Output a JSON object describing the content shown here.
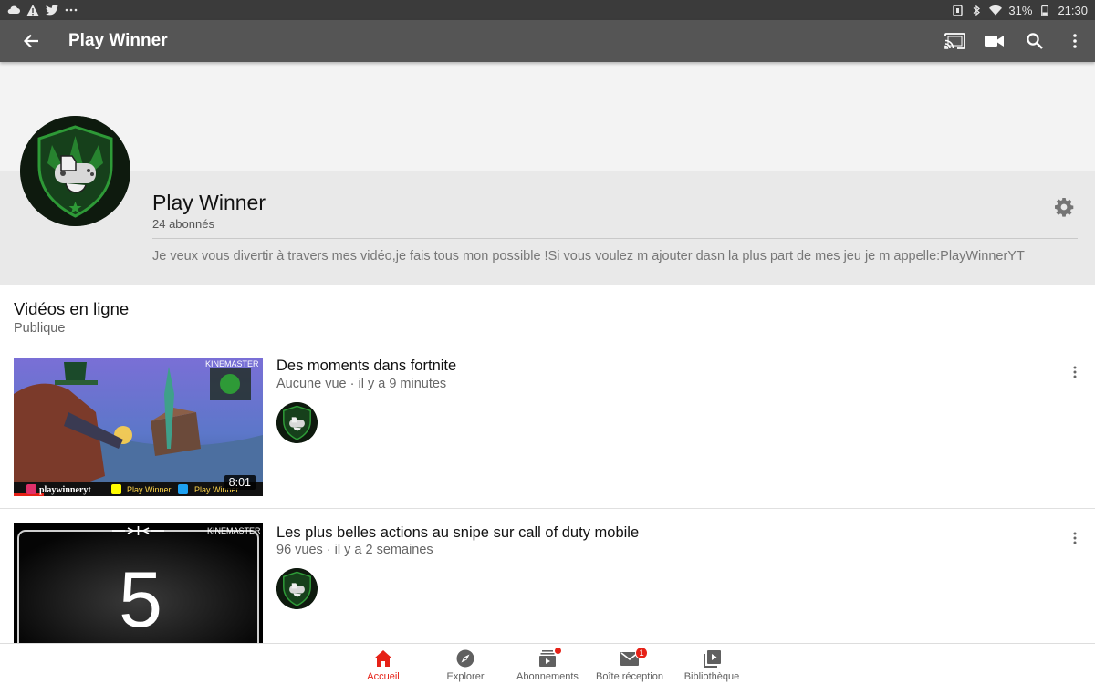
{
  "status_bar": {
    "icons_left": [
      "cloud-icon",
      "warning-icon",
      "twitter-icon",
      "more-dots-icon"
    ],
    "battery": "31%",
    "time": "21:30"
  },
  "app_bar": {
    "title": "Play Winner"
  },
  "channel": {
    "name": "Play Winner",
    "subscribers": "24 abonnés",
    "description": "Je veux vous divertir à travers mes vidéo,je fais tous mon possible !Si vous voulez m ajouter dasn la plus part de mes jeu je m appelle:PlayWinnerYT",
    "colors": {
      "banner": "#f3f3f3",
      "info_bg": "#e9e9e9",
      "avatar_green": "#2e9a37"
    }
  },
  "section": {
    "title": "Vidéos en ligne",
    "subtitle": "Publique"
  },
  "videos": [
    {
      "title": "Des moments dans  fortnite",
      "meta": "Aucune vue · il y a 9 minutes",
      "duration": "8:01",
      "thumb_text": {
        "watermark": "KINEMASTER",
        "social_1": "playwinneryt",
        "social_2": "Play Winner",
        "social_3": "Play Winner"
      }
    },
    {
      "title": "Les plus belles actions au snipe sur call of duty mobile",
      "meta": "96 vues · il y a 2 semaines",
      "thumb_text": {
        "watermark": "KINEMASTER",
        "big_number": "5"
      }
    }
  ],
  "bottom_nav": {
    "items": [
      {
        "label": "Accueil",
        "icon": "home-icon",
        "active": true
      },
      {
        "label": "Explorer",
        "icon": "compass-icon"
      },
      {
        "label": "Abonnements",
        "icon": "subscriptions-icon",
        "dot": true
      },
      {
        "label": "Boîte réception",
        "icon": "inbox-icon",
        "badge": "1"
      },
      {
        "label": "Bibliothèque",
        "icon": "library-icon"
      }
    ],
    "accent_color": "#e62117"
  }
}
